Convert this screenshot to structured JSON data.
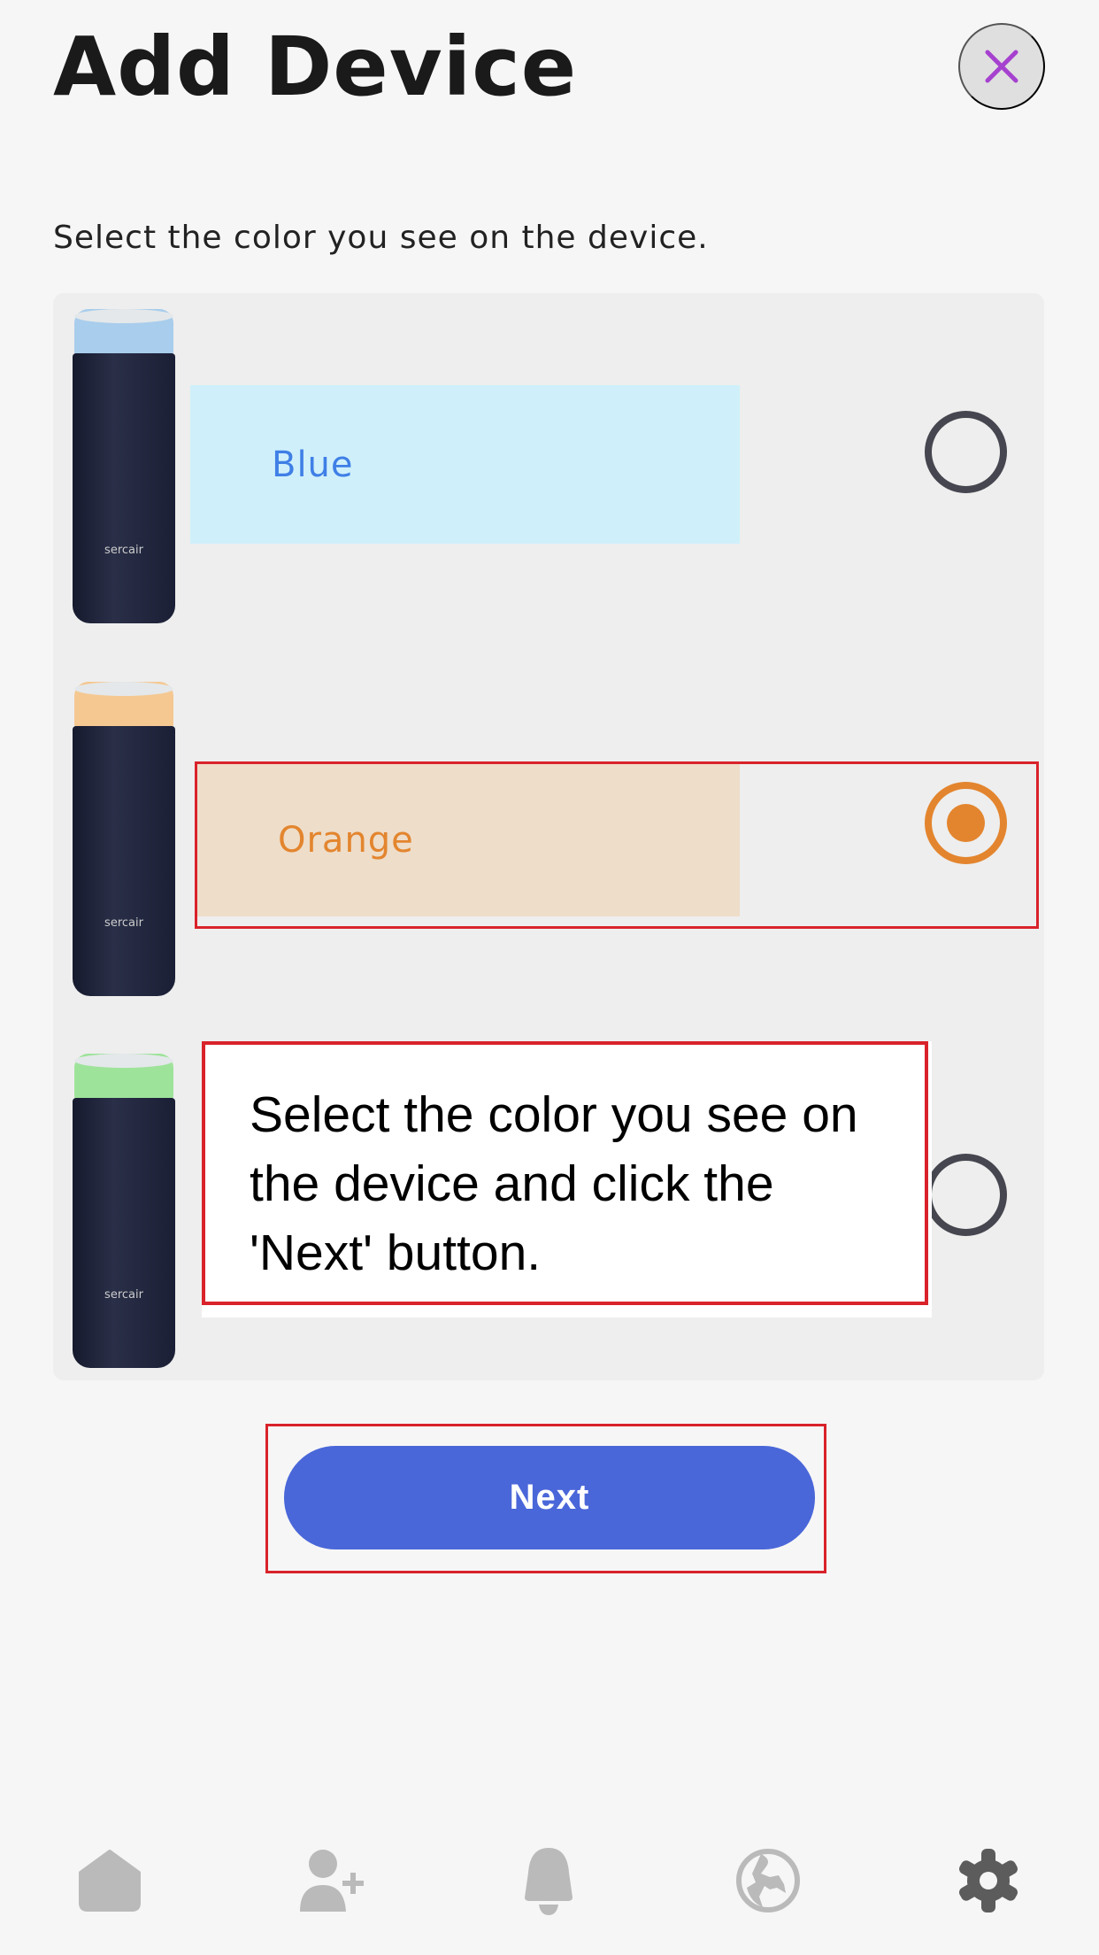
{
  "header": {
    "title": "Add Device"
  },
  "instruction": "Select the color you see on the device.",
  "device_brand": "sercair",
  "options": [
    {
      "label": "Blue",
      "text_color": "#3f7fe6",
      "box_color": "#cff0fb",
      "cap_color": "#a9cdec",
      "selected": false
    },
    {
      "label": "Orange",
      "text_color": "#e3852e",
      "box_color": "#eeddc9",
      "cap_color": "#f5c892",
      "selected": true
    },
    {
      "cap_color": "#9ee39a",
      "selected": false
    }
  ],
  "tooltip": "Select the color you see on the device and click the 'Next' button.",
  "next_label": "Next",
  "accent_color": "#4a67d9",
  "bottom_nav": [
    {
      "icon": "home-icon",
      "active": false
    },
    {
      "icon": "add-user-icon",
      "active": false
    },
    {
      "icon": "bell-icon",
      "active": false
    },
    {
      "icon": "globe-icon",
      "active": false
    },
    {
      "icon": "gear-icon",
      "active": true
    }
  ]
}
